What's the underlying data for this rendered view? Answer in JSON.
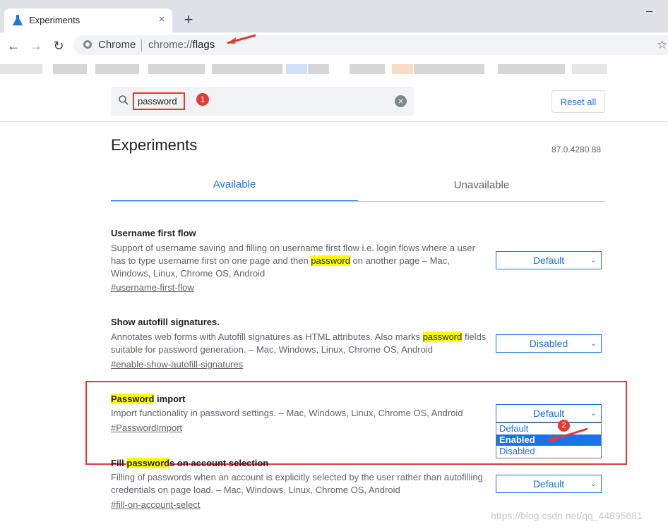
{
  "tab": {
    "title": "Experiments",
    "close": "×"
  },
  "new_tab": "+",
  "omnibox": {
    "chip": "Chrome",
    "url_prefix": "chrome://",
    "url_path": "flags",
    "star": "☆"
  },
  "nav": {
    "back": "←",
    "forward": "→",
    "reload": "↻"
  },
  "search": {
    "value": "password",
    "clear": "×"
  },
  "reset_label": "Reset all",
  "page_title": "Experiments",
  "version": "87.0.4280.88",
  "tabs": {
    "available": "Available",
    "unavailable": "Unavailable"
  },
  "experiments": [
    {
      "title": "Username first flow",
      "desc_before": "Support of username saving and filling on username first flow i.e. login flows where a user has to type username first on one page and then ",
      "desc_highlight": "password",
      "desc_after": " on another page – Mac, Windows, Linux, Chrome OS, Android",
      "link": "#username-first-flow",
      "value": "Default"
    },
    {
      "title": "Show autofill signatures.",
      "desc_before": "Annotates web forms with Autofill signatures as HTML attributes. Also marks ",
      "desc_highlight": "password",
      "desc_after": " fields suitable for password generation. – Mac, Windows, Linux, Chrome OS, Android",
      "link": "#enable-show-autofill-signatures",
      "value": "Disabled"
    },
    {
      "title_highlight": "Password",
      "title_after": " import",
      "desc": "Import functionality in password settings. – Mac, Windows, Linux, Chrome OS, Android",
      "link": "#PasswordImport",
      "value": "Default",
      "options": [
        "Default",
        "Enabled",
        "Disabled"
      ]
    },
    {
      "title_before": "Fill ",
      "title_highlight": "password",
      "title_after": "s on account selection",
      "desc": "Filling of passwords when an account is explicitly selected by the user rather than autofilling credentials on page load. – Mac, Windows, Linux, Chrome OS, Android",
      "link": "#fill-on-account-select",
      "value": "Default"
    }
  ],
  "badges": [
    "1",
    "2"
  ],
  "chevron": "⌄",
  "watermark": "https://blog.csdn.net/qq_44895681",
  "colors": {
    "accent": "#1a73e8",
    "highlight": "#ffff00",
    "annotation": "#e53935"
  }
}
